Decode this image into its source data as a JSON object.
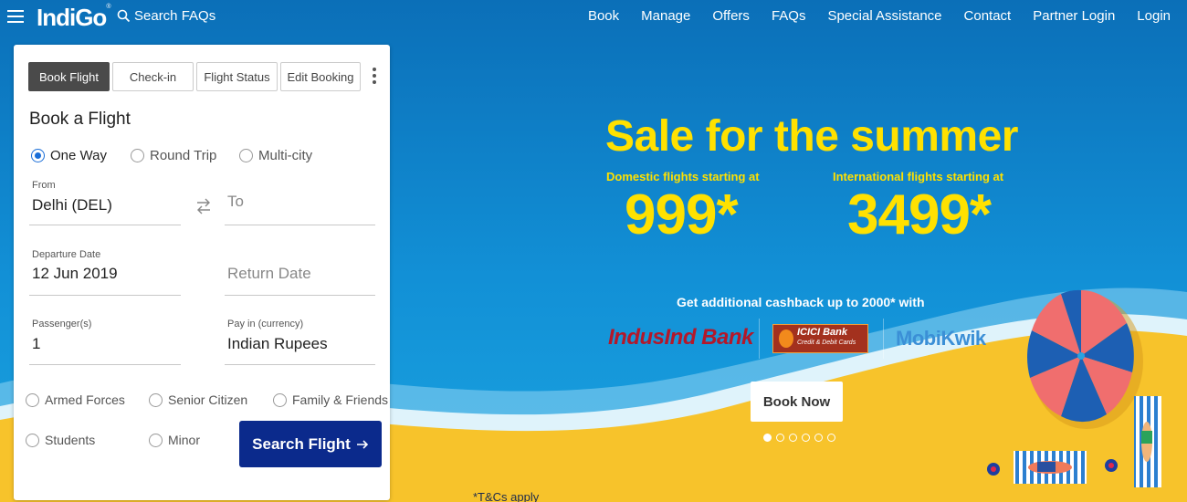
{
  "header": {
    "brand": "IndiGo",
    "brand_mark": "®",
    "search_label": "Search FAQs",
    "nav": [
      "Book",
      "Manage",
      "Offers",
      "FAQs",
      "Special Assistance",
      "Contact",
      "Partner Login",
      "Login"
    ]
  },
  "booking": {
    "tabs": [
      "Book Flight",
      "Check-in",
      "Flight Status",
      "Edit Booking"
    ],
    "active_tab": "Book Flight",
    "title": "Book a Flight",
    "trip_types": [
      "One Way",
      "Round Trip",
      "Multi-city"
    ],
    "selected_trip_type": "One Way",
    "from_label": "From",
    "from_value": "Delhi (DEL)",
    "to_placeholder": "To",
    "departure_label": "Departure Date",
    "departure_value": "12 Jun 2019",
    "return_placeholder": "Return Date",
    "passengers_label": "Passenger(s)",
    "passengers_value": "1",
    "currency_label": "Pay in (currency)",
    "currency_value": "Indian Rupees",
    "special_fares": [
      "Armed Forces",
      "Senior Citizen",
      "Family & Friends",
      "Students",
      "Minor"
    ],
    "search_button": "Search Flight"
  },
  "promo": {
    "title": "Sale for the summer",
    "domestic_label": "Domestic flights starting at",
    "domestic_price": "999*",
    "international_label": "International flights starting at",
    "international_price": "3499*",
    "currency_symbol": "",
    "cashback": "Get additional cashback up to 2000* with",
    "partners": {
      "indusind": "IndusInd Bank",
      "icici_line1": "ICICI Bank",
      "icici_line2": "Credit & Debit Cards",
      "mobikwik": "MobiKwik"
    },
    "book_now": "Book Now",
    "slide_count": 6,
    "active_slide": 1,
    "tnc": "*T&Cs apply"
  },
  "colors": {
    "sky": "#0f7cc4",
    "sand": "#f7c32b",
    "promo_yellow": "#ffe100",
    "search_button": "#0b2a8c",
    "radio_active": "#1a6ed8"
  }
}
